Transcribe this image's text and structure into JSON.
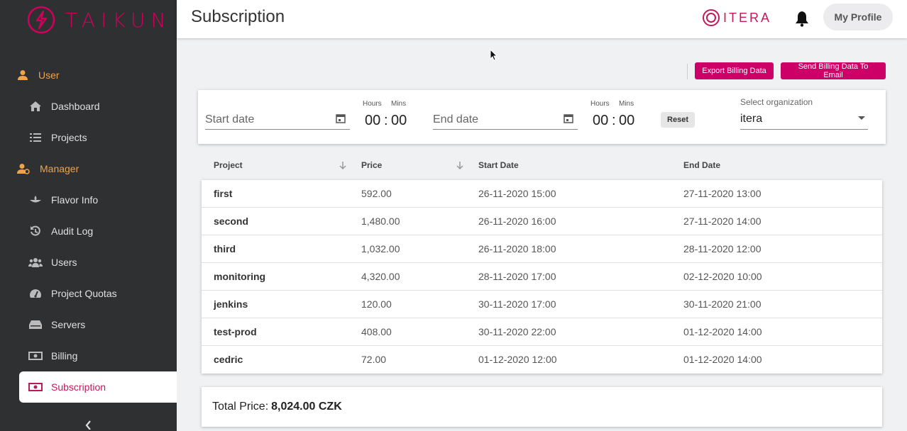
{
  "brand": {
    "logo_text": "TAIKUN",
    "logo_color": "#d1005d"
  },
  "sidebar": {
    "sections": [
      {
        "label": "User",
        "icon": "user-icon"
      },
      {
        "label": "Manager",
        "icon": "manager-icon"
      }
    ],
    "items": [
      {
        "label": "Dashboard",
        "icon": "home-icon"
      },
      {
        "label": "Projects",
        "icon": "list-icon"
      },
      {
        "label": "Flavor Info",
        "icon": "flavor-icon"
      },
      {
        "label": "Audit Log",
        "icon": "history-icon"
      },
      {
        "label": "Users",
        "icon": "users-icon"
      },
      {
        "label": "Project Quotas",
        "icon": "gauge-icon"
      },
      {
        "label": "Servers",
        "icon": "server-icon"
      },
      {
        "label": "Billing",
        "icon": "money-icon"
      },
      {
        "label": "Subscription",
        "icon": "money-icon",
        "active": true
      }
    ]
  },
  "header": {
    "title": "Subscription",
    "org_logo": "ITERA",
    "profile_label": "My Profile"
  },
  "actions": {
    "export_label": "Export Billing Data",
    "send_label": "Send Billing Data To Email"
  },
  "filter": {
    "start_placeholder": "Start date",
    "end_placeholder": "End date",
    "hours_label": "Hours",
    "mins_label": "Mins",
    "start_hours": "00",
    "start_mins": "00",
    "end_hours": "00",
    "end_mins": "00",
    "time_sep": ":",
    "reset_label": "Reset",
    "org_label": "Select organization",
    "org_value": "itera"
  },
  "table": {
    "headers": [
      "Project",
      "Price",
      "Start Date",
      "End Date"
    ],
    "rows": [
      [
        "first",
        "592.00",
        "26-11-2020 15:00",
        "27-11-2020 13:00"
      ],
      [
        "second",
        "1,480.00",
        "26-11-2020 16:00",
        "27-11-2020 14:00"
      ],
      [
        "third",
        "1,032.00",
        "26-11-2020 18:00",
        "28-11-2020 12:00"
      ],
      [
        "monitoring",
        "4,320.00",
        "28-11-2020 17:00",
        "02-12-2020 10:00"
      ],
      [
        "jenkins",
        "120.00",
        "30-11-2020 17:00",
        "30-11-2020 21:00"
      ],
      [
        "test-prod",
        "408.00",
        "30-11-2020 22:00",
        "01-12-2020 14:00"
      ],
      [
        "cedric",
        "72.00",
        "01-12-2020 12:00",
        "01-12-2020 14:00"
      ]
    ]
  },
  "total": {
    "label": "Total Price:",
    "value": "8,024.00 CZK"
  }
}
